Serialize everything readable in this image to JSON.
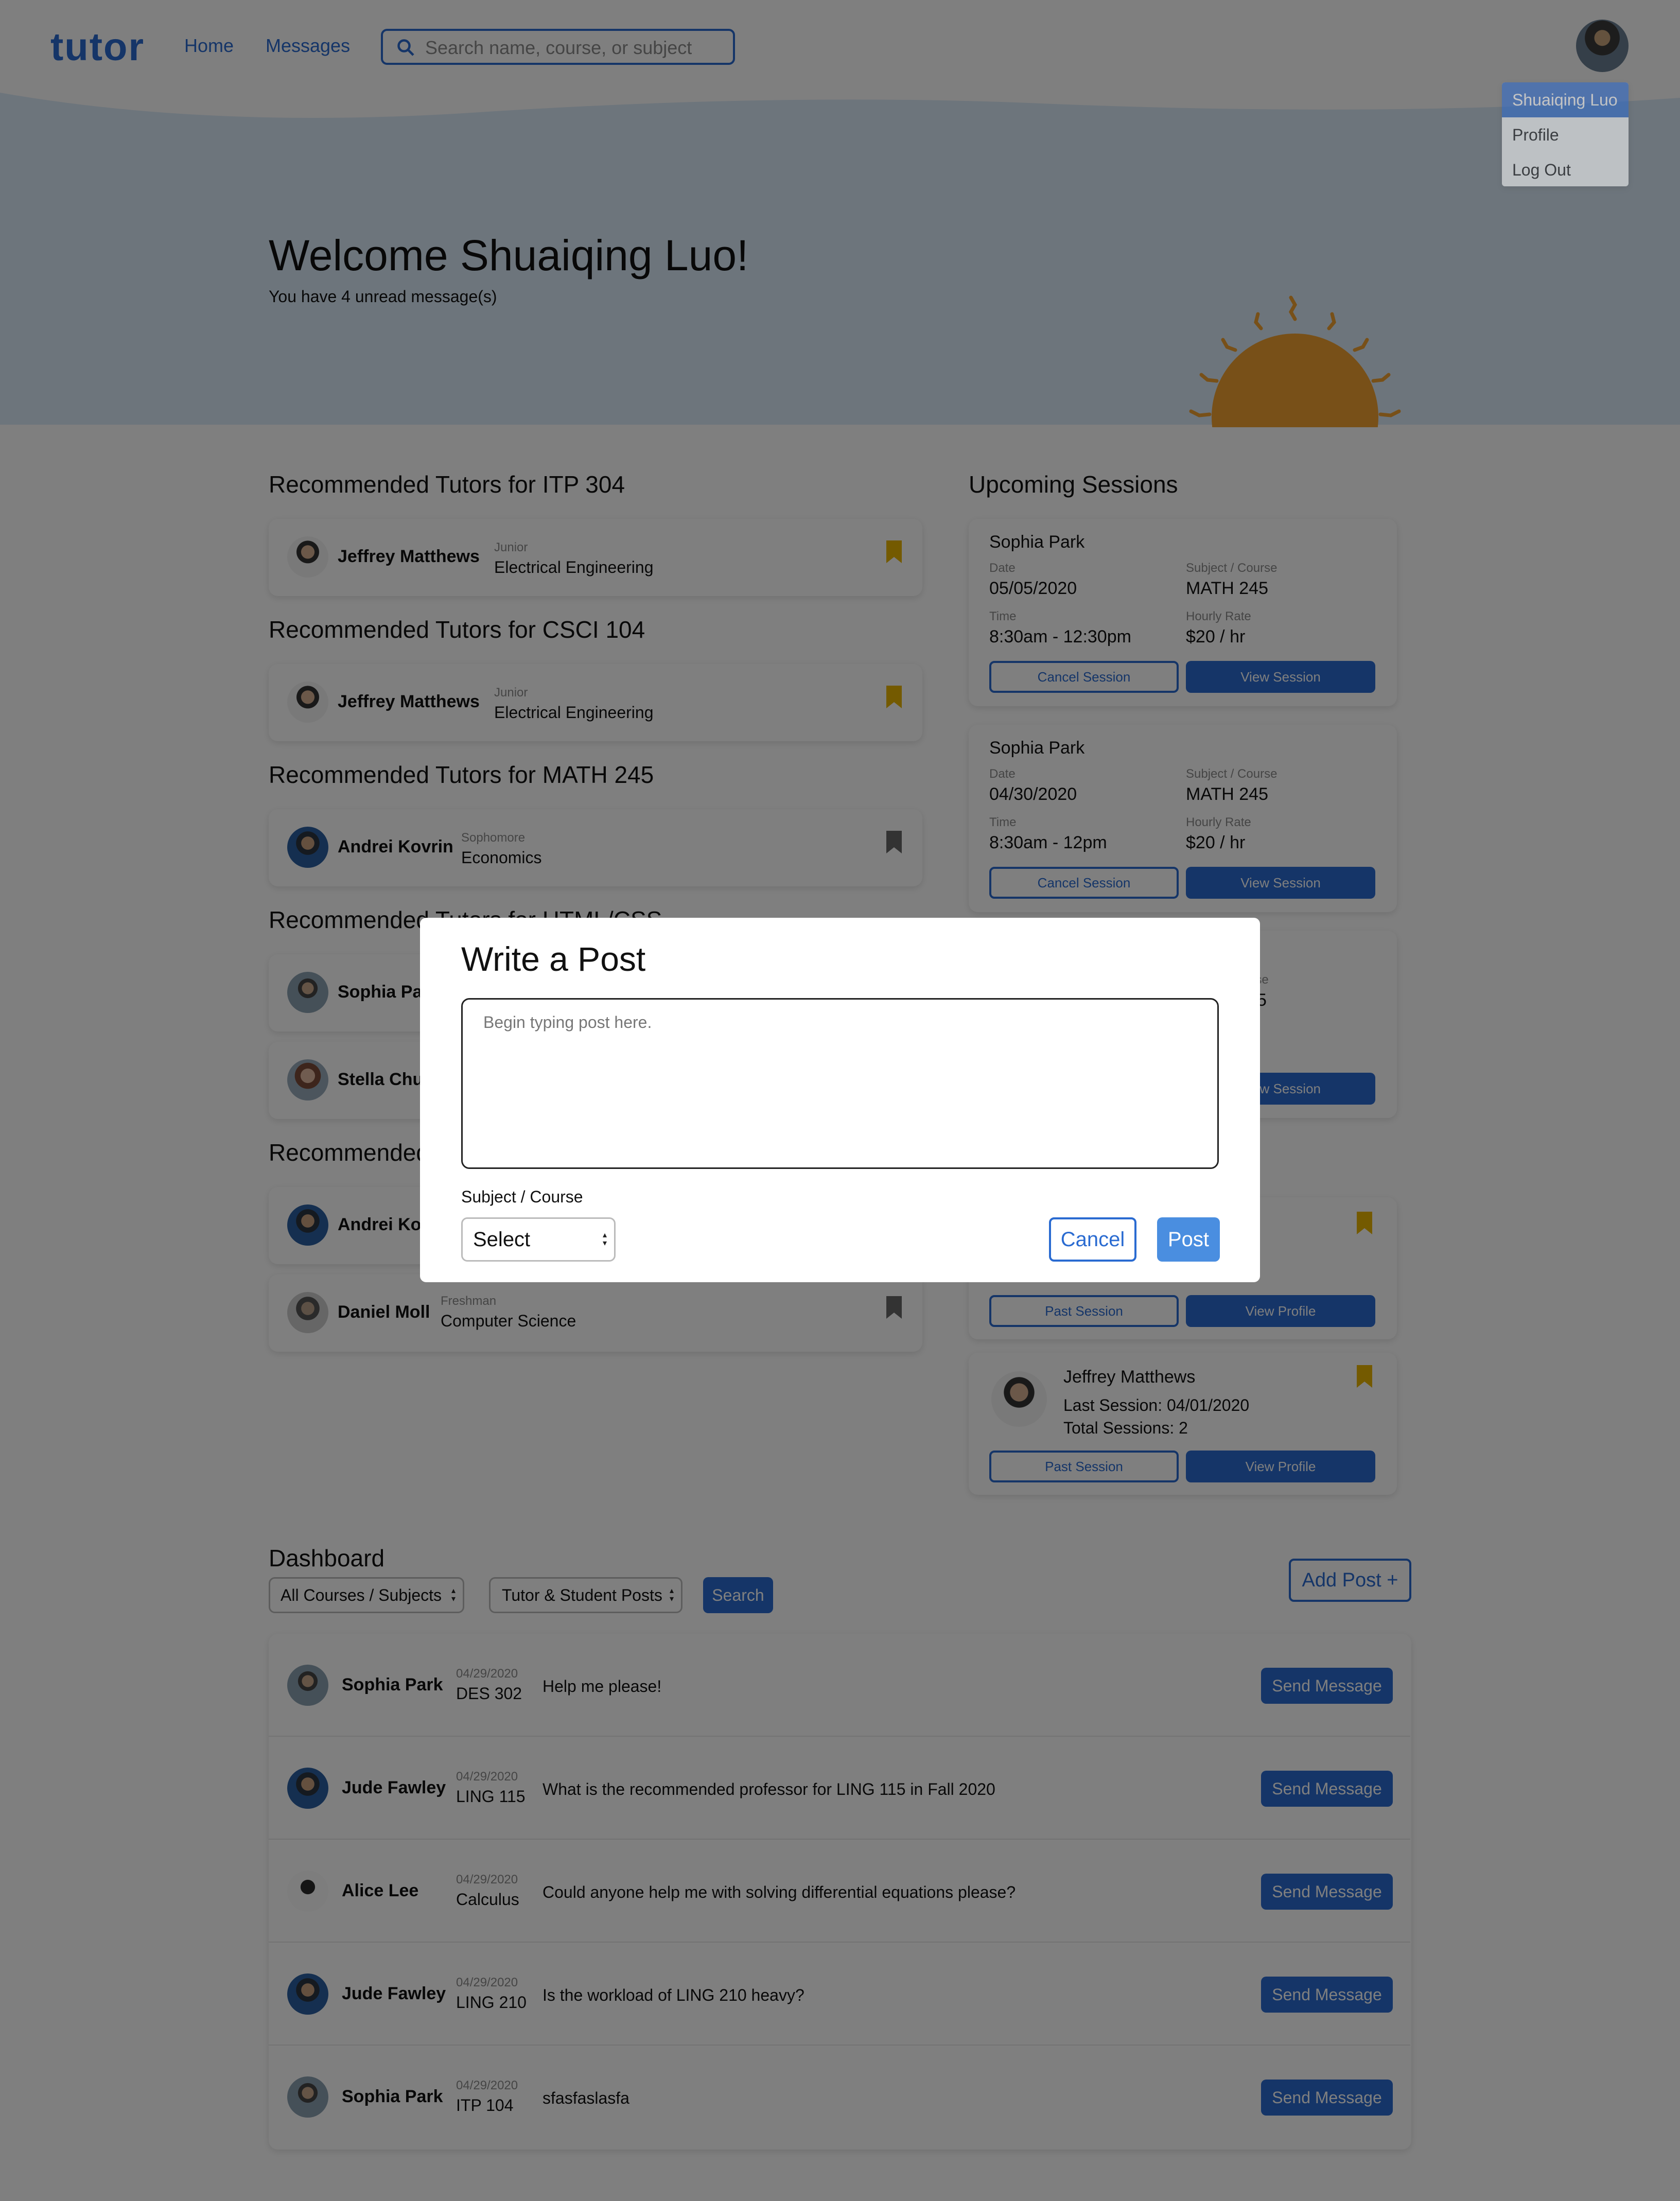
{
  "nav": {
    "logo": "tutor",
    "home": "Home",
    "messages": "Messages",
    "search_placeholder": "Search name, course, or subject",
    "dropdown": [
      "Shuaiqing Luo",
      "Profile",
      "Log Out"
    ]
  },
  "hero": {
    "title": "Welcome Shuaiqing Luo!",
    "subtitle": "You have 4 unread message(s)"
  },
  "recommended": [
    {
      "title": "Recommended Tutors for ITP 304",
      "tutors": [
        {
          "name": "Jeffrey Matthews",
          "year": "Junior",
          "major": "Electrical Engineering",
          "saved": true
        }
      ]
    },
    {
      "title": "Recommended Tutors for CSCI 104",
      "tutors": [
        {
          "name": "Jeffrey Matthews",
          "year": "Junior",
          "major": "Electrical Engineering",
          "saved": true
        }
      ]
    },
    {
      "title": "Recommended Tutors for MATH 245",
      "tutors": [
        {
          "name": "Andrei Kovrin",
          "year": "Sophomore",
          "major": "Economics",
          "saved": false
        }
      ]
    },
    {
      "title": "Recommended Tutors for HTML/CSS",
      "tutors": [
        {
          "name": "Sophia Par"
        },
        {
          "name": "Stella Chu"
        }
      ]
    },
    {
      "title": "Recommended",
      "tutors": [
        {
          "name": "Andrei Kov"
        },
        {
          "name": "Daniel Moll",
          "year": "Freshman",
          "major": "Computer Science",
          "saved": false
        }
      ]
    }
  ],
  "sessions": {
    "title": "Upcoming Sessions",
    "labels": {
      "date": "Date",
      "time": "Time",
      "subject": "Subject / Course",
      "rate": "Hourly Rate",
      "cancel": "Cancel Session",
      "view": "View Session"
    },
    "items": [
      {
        "name": "Sophia Park",
        "date": "05/05/2020",
        "time": "8:30am - 12:30pm",
        "subject": "MATH 245",
        "rate": "$20 / hr"
      },
      {
        "name": "Sophia Park",
        "date": "04/30/2020",
        "time": "8:30am - 12pm",
        "subject": "MATH 245",
        "rate": "$20 / hr"
      }
    ],
    "partial": {
      "subject_label_frag": "urse",
      "subject_frag": "5",
      "view_frag": "w Session"
    }
  },
  "past_tutors": {
    "past_label": "Past Session",
    "view_label": "View Profile",
    "item": {
      "name": "Jeffrey Matthews",
      "last": "Last Session: 04/01/2020",
      "total": "Total Sessions: 2"
    }
  },
  "dashboard": {
    "title": "Dashboard",
    "filter_course": "All Courses / Subjects",
    "filter_type": "Tutor & Student Posts",
    "search_label": "Search",
    "add_post": "Add Post +",
    "send_label": "Send Message",
    "posts": [
      {
        "name": "Sophia Park",
        "date": "04/29/2020",
        "course": "DES 302",
        "text": "Help me please!"
      },
      {
        "name": "Jude Fawley",
        "date": "04/29/2020",
        "course": "LING 115",
        "text": "What is the recommended professor for LING 115 in Fall 2020"
      },
      {
        "name": "Alice Lee",
        "date": "04/29/2020",
        "course": "Calculus",
        "text": "Could anyone help me with solving differential equations please?"
      },
      {
        "name": "Jude Fawley",
        "date": "04/29/2020",
        "course": "LING 210",
        "text": "Is the workload of LING 210 heavy?"
      },
      {
        "name": "Sophia Park",
        "date": "04/29/2020",
        "course": "ITP 104",
        "text": "sfasfaslasfa"
      }
    ]
  },
  "modal": {
    "title": "Write a Post",
    "placeholder": "Begin typing post here.",
    "subject_label": "Subject / Course",
    "select_value": "Select",
    "cancel": "Cancel",
    "post": "Post"
  },
  "colors": {
    "primary": "#2a6bd1",
    "bookmark_saved": "#e8b400",
    "bookmark_unsaved": "#666666",
    "hero_bg": "#dbeaf8",
    "sun": "#f0a030"
  }
}
